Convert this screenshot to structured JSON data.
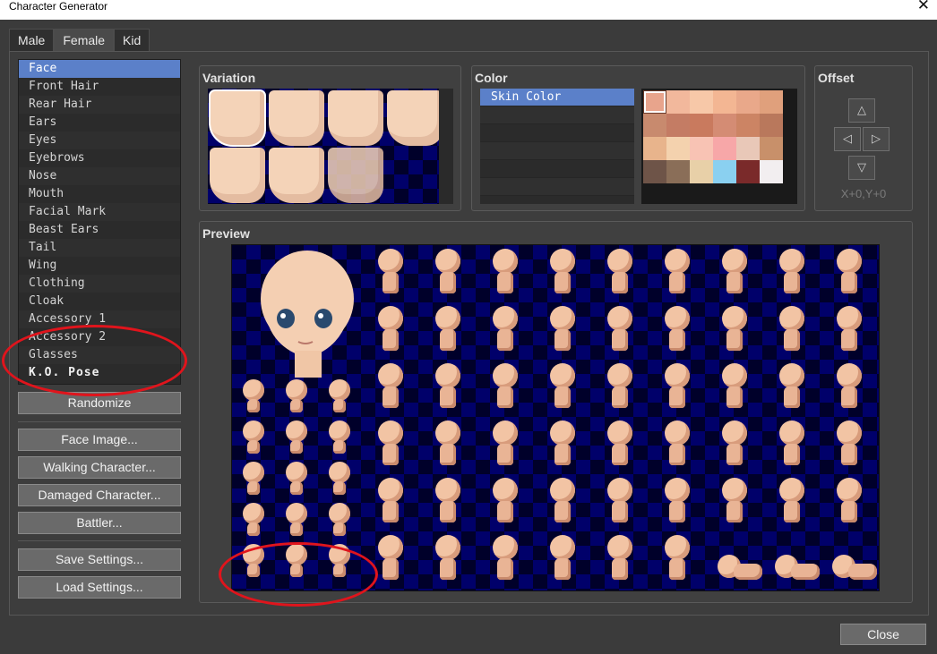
{
  "window": {
    "title": "Character Generator",
    "close_glyph": "✕"
  },
  "tabs": [
    {
      "label": "Male"
    },
    {
      "label": "Female"
    },
    {
      "label": "Kid"
    }
  ],
  "parts": [
    {
      "label": "Face"
    },
    {
      "label": "Front Hair"
    },
    {
      "label": "Rear Hair"
    },
    {
      "label": "Ears"
    },
    {
      "label": "Eyes"
    },
    {
      "label": "Eyebrows"
    },
    {
      "label": "Nose"
    },
    {
      "label": "Mouth"
    },
    {
      "label": "Facial Mark"
    },
    {
      "label": "Beast Ears"
    },
    {
      "label": "Tail"
    },
    {
      "label": "Wing"
    },
    {
      "label": "Clothing"
    },
    {
      "label": "Cloak"
    },
    {
      "label": "Accessory 1"
    },
    {
      "label": "Accessory 2"
    },
    {
      "label": "Glasses"
    },
    {
      "label": "K.O. Pose"
    }
  ],
  "buttons": {
    "randomize": "Randomize",
    "face_image": "Face Image...",
    "walking_character": "Walking Character...",
    "damaged_character": "Damaged Character...",
    "battler": "Battler...",
    "save_settings": "Save Settings...",
    "load_settings": "Load Settings...",
    "close": "Close"
  },
  "variation": {
    "title": "Variation",
    "selected_index": 0
  },
  "color": {
    "title": "Color",
    "items": [
      {
        "label": "Skin Color"
      }
    ],
    "swatches": [
      "#e8a48c",
      "#f2b89c",
      "#f7c8a8",
      "#f3b693",
      "#e9a88a",
      "#e0a07c",
      "#c88a6e",
      "#c47c64",
      "#c97a5e",
      "#d48c74",
      "#cc8464",
      "#b9785c",
      "#e8b48c",
      "#f4d2ae",
      "#f8c3b4",
      "#f7a7a8",
      "#e9c8b8",
      "#c8906a",
      "#6e5448",
      "#8a6e58",
      "#e8d0a8",
      "#8ad0f0",
      "#7a2a2a",
      "#f2eef0"
    ],
    "selected_swatch": 0
  },
  "offset": {
    "title": "Offset",
    "readout": "X+0,Y+0"
  },
  "preview": {
    "title": "Preview"
  }
}
